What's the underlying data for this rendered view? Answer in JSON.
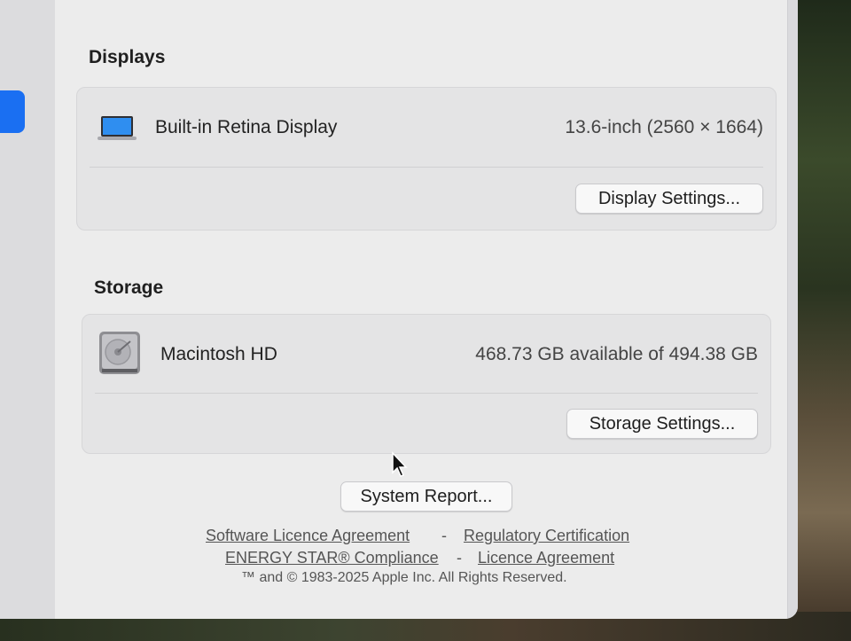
{
  "displays": {
    "heading": "Displays",
    "name": "Built-in Retina Display",
    "detail": "13.6-inch (2560 × 1664)",
    "icon": "laptop-display-icon",
    "settings_button": "Display Settings..."
  },
  "storage": {
    "heading": "Storage",
    "name": "Macintosh HD",
    "detail": "468.73 GB available of 494.38 GB",
    "icon": "hard-drive-icon",
    "settings_button": "Storage Settings..."
  },
  "system_report_button": "System Report...",
  "footer": {
    "link_software_licence": "Software Licence Agreement",
    "link_regulatory": "Regulatory Certification",
    "link_energy_star": "ENERGY STAR® Compliance",
    "link_licence": "Licence Agreement",
    "separator": "-",
    "copyright": "™ and © 1983-2025 Apple Inc. All Rights Reserved."
  },
  "colors": {
    "accent": "#1a6ff2",
    "background": "#ececec"
  }
}
